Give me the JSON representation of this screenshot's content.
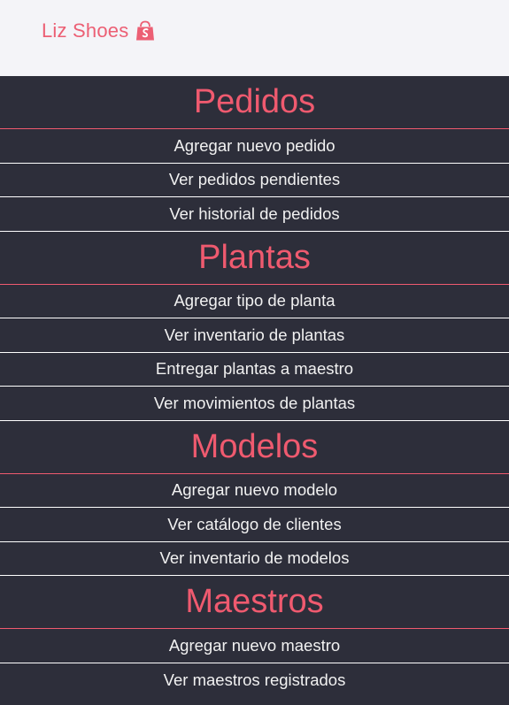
{
  "header": {
    "brand": "Liz Shoes",
    "brand_icon": "shopping-bag-icon"
  },
  "colors": {
    "accent": "#ef5a6f",
    "background": "#2d2e3a",
    "topbar": "#f4f4f8",
    "item_text": "#f1f1f1"
  },
  "sections": [
    {
      "title": "Pedidos",
      "items": [
        "Agregar nuevo pedido",
        "Ver pedidos pendientes",
        "Ver historial de pedidos"
      ]
    },
    {
      "title": "Plantas",
      "items": [
        "Agregar tipo de planta",
        "Ver inventario de plantas",
        "Entregar plantas a maestro",
        "Ver movimientos de plantas"
      ]
    },
    {
      "title": "Modelos",
      "items": [
        "Agregar nuevo modelo",
        "Ver catálogo de clientes",
        "Ver inventario de modelos"
      ]
    },
    {
      "title": "Maestros",
      "items": [
        "Agregar nuevo maestro",
        "Ver maestros registrados"
      ]
    }
  ]
}
